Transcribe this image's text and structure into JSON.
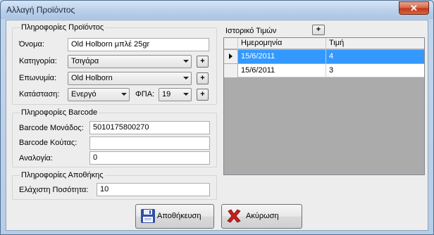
{
  "window": {
    "title": "Αλλαγή Προϊόντος",
    "close_glyph": "✕"
  },
  "product_info": {
    "title": "Πληροφορίες Προϊόντος",
    "name_label": "Όνομα:",
    "name_value": "Old Holborn μπλέ 25gr",
    "category_label": "Κατηγορία:",
    "category_value": "Τσιγάρα",
    "brand_label": "Επωνυμία:",
    "brand_value": "Old Holborn",
    "status_label": "Κατάσταση:",
    "status_value": "Ενεργό",
    "vat_label": "ΦΠΑ:",
    "vat_value": "19",
    "plus": "+"
  },
  "barcode_info": {
    "title": "Πληροφορίες Barcode",
    "unit_label": "Barcode Μονάδος:",
    "unit_value": "5010175800270",
    "box_label": "Barcode Κούτας:",
    "box_value": "",
    "ratio_label": "Αναλογία:",
    "ratio_value": "0"
  },
  "storage_info": {
    "title": "Πληροφορίες Αποθήκης",
    "min_qty_label": "Ελάχιστη Ποσότητα:",
    "min_qty_value": "10"
  },
  "price_history": {
    "title": "Ιστορικό Τιμών",
    "add": "+",
    "columns": [
      "Ημερομηνία",
      "Τιμή"
    ],
    "rows": [
      {
        "date": "15/6/2011",
        "price": "4",
        "selected": true
      },
      {
        "date": "15/6/2011",
        "price": "3",
        "selected": false
      }
    ]
  },
  "buttons": {
    "save": "Αποθήκευση",
    "cancel": "Ακύρωση"
  },
  "colors": {
    "selection": "#3399ff",
    "save_icon": "#2f4fa8",
    "cancel_icon": "#c81e1e"
  }
}
